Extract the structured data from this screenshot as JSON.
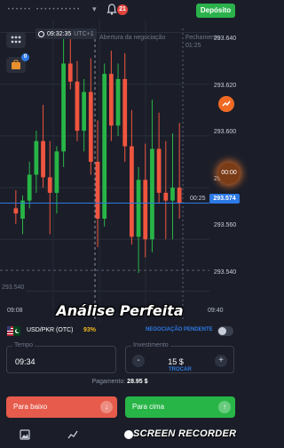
{
  "header": {
    "account_masked": "•••••• •••••••••••",
    "notifications": "21",
    "deposit_label": "Depósito"
  },
  "chart": {
    "server_time": "09:32:35",
    "utc_label": "UTC+1",
    "purchase_label": "Abertura da negociação",
    "expiry_label": "Fechamento",
    "expiry_time": "01:25",
    "current_price": "293.574",
    "countdown_tag": "00:25",
    "countdown_circle": "00:00",
    "low_tag": "293.540",
    "price_labels": [
      "293.640",
      "293.620",
      "293.600",
      "293.580",
      "293.560",
      "293.540"
    ],
    "time_labels": [
      "09:08",
      "09:40"
    ],
    "colors": {
      "up": "#28b547",
      "down": "#f0553f",
      "accent": "#2d79e5"
    }
  },
  "overlay_caption": "Análise Perfeita",
  "asset": {
    "pair": "USD/PKR (OTC)",
    "payout": "93%",
    "pending_label": "NEGOCIAÇÃO PENDENTE"
  },
  "time_field": {
    "label": "Tempo",
    "value": "09:34"
  },
  "investment_field": {
    "label": "Investimento",
    "value": "15 $",
    "minus": "-",
    "plus": "+",
    "swap_label": "TROCAR"
  },
  "payment": {
    "label": "Pagamento:",
    "value": "28.95 $"
  },
  "actions": {
    "down_label": "Para baixo",
    "up_label": "Para cima",
    "down_arrow": "↓",
    "up_arrow": "↑"
  },
  "recorder_watermark": "SCREEN RECORDER",
  "chart_data": {
    "type": "candlestick",
    "ylim": [
      293.535,
      293.645
    ],
    "ticks": [
      293.64,
      293.62,
      293.6,
      293.58,
      293.56,
      293.54
    ],
    "x_labels": [
      "09:08",
      "09:40"
    ],
    "current_price": 293.574,
    "candles": [
      {
        "o": 293.572,
        "h": 293.579,
        "l": 293.566,
        "c": 293.57
      },
      {
        "o": 293.568,
        "h": 293.577,
        "l": 293.562,
        "c": 293.575
      },
      {
        "o": 293.575,
        "h": 293.59,
        "l": 293.572,
        "c": 293.585
      },
      {
        "o": 293.585,
        "h": 293.602,
        "l": 293.578,
        "c": 293.598
      },
      {
        "o": 293.598,
        "h": 293.612,
        "l": 293.58,
        "c": 293.584
      },
      {
        "o": 293.584,
        "h": 293.598,
        "l": 293.562,
        "c": 293.578
      },
      {
        "o": 293.578,
        "h": 293.596,
        "l": 293.57,
        "c": 293.594
      },
      {
        "o": 293.594,
        "h": 293.638,
        "l": 293.588,
        "c": 293.628
      },
      {
        "o": 293.628,
        "h": 293.64,
        "l": 293.618,
        "c": 293.621
      },
      {
        "o": 293.621,
        "h": 293.629,
        "l": 293.598,
        "c": 293.602
      },
      {
        "o": 293.602,
        "h": 293.622,
        "l": 293.594,
        "c": 293.617
      },
      {
        "o": 293.617,
        "h": 293.63,
        "l": 293.585,
        "c": 293.59
      },
      {
        "o": 293.59,
        "h": 293.606,
        "l": 293.557,
        "c": 293.568
      },
      {
        "o": 293.568,
        "h": 293.628,
        "l": 293.565,
        "c": 293.624
      },
      {
        "o": 293.624,
        "h": 293.633,
        "l": 293.598,
        "c": 293.604
      },
      {
        "o": 293.604,
        "h": 293.628,
        "l": 293.6,
        "c": 293.622
      },
      {
        "o": 293.622,
        "h": 293.632,
        "l": 293.59,
        "c": 293.596
      },
      {
        "o": 293.596,
        "h": 293.61,
        "l": 293.558,
        "c": 293.561
      },
      {
        "o": 293.561,
        "h": 293.588,
        "l": 293.547,
        "c": 293.583
      },
      {
        "o": 293.583,
        "h": 293.597,
        "l": 293.553,
        "c": 293.56
      },
      {
        "o": 293.56,
        "h": 293.614,
        "l": 293.555,
        "c": 293.595
      },
      {
        "o": 293.595,
        "h": 293.609,
        "l": 293.574,
        "c": 293.578
      },
      {
        "o": 293.578,
        "h": 293.598,
        "l": 293.56,
        "c": 293.575
      },
      {
        "o": 293.575,
        "h": 293.601,
        "l": 293.56,
        "c": 293.58
      },
      {
        "o": 293.58,
        "h": 293.605,
        "l": 293.568,
        "c": 293.574
      }
    ]
  }
}
